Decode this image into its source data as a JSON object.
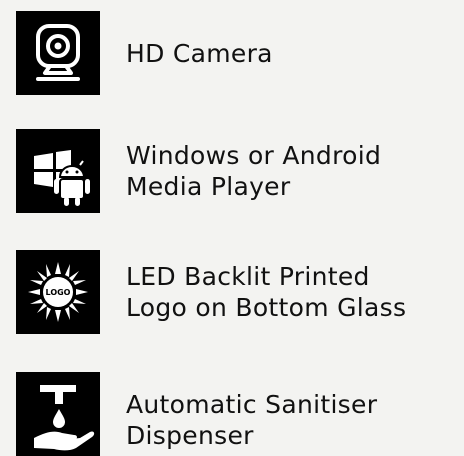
{
  "features": [
    {
      "icon": "webcam-icon",
      "label": "HD Camera"
    },
    {
      "icon": "windows-android-icon",
      "label": "Windows or Android Media Player"
    },
    {
      "icon": "backlit-logo-icon",
      "label": "LED Backlit Printed Logo on Bottom Glass",
      "icon_text": "LOGO"
    },
    {
      "icon": "hand-sanitiser-icon",
      "label": "Automatic Sanitiser Dispenser"
    }
  ]
}
